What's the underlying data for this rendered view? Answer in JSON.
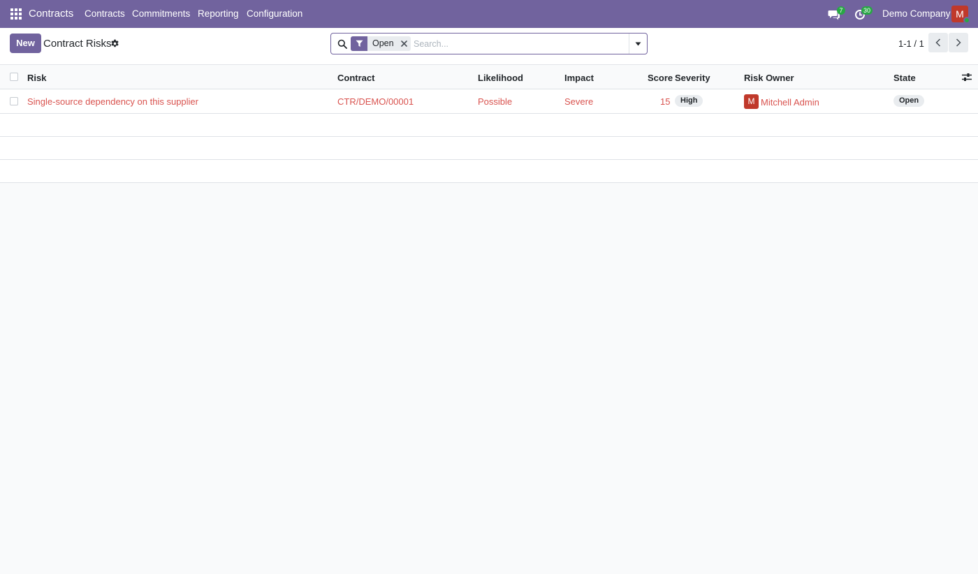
{
  "navbar": {
    "brand": "Contracts",
    "menu": [
      "Contracts",
      "Commitments",
      "Reporting",
      "Configuration"
    ],
    "messages_count": "7",
    "activities_count": "30",
    "company": "Demo Company",
    "user_initial": "M"
  },
  "control_panel": {
    "new_label": "New",
    "title": "Contract Risks",
    "search": {
      "facet": "Open",
      "placeholder": "Search..."
    },
    "pager": "1-1 / 1"
  },
  "list": {
    "columns": [
      "Risk",
      "Contract",
      "Likelihood",
      "Impact",
      "Score",
      "Severity",
      "Risk Owner",
      "State"
    ],
    "rows": [
      {
        "risk": "Single-source dependency on this supplier",
        "contract": "CTR/DEMO/00001",
        "likelihood": "Possible",
        "impact": "Severe",
        "score": "15",
        "severity": "High",
        "owner_initial": "M",
        "owner": "Mitchell Admin",
        "state": "Open"
      }
    ]
  },
  "colors": {
    "brand": "#71639e",
    "link": "#d9534f",
    "badge": "#28a745",
    "avatar": "#c0392b"
  },
  "icons": [
    "apps-grid-icon",
    "chat-icon",
    "activity-clock-icon",
    "gear-icon",
    "search-icon",
    "filter-icon",
    "close-icon",
    "caret-down-icon",
    "chevron-left-icon",
    "chevron-right-icon",
    "optional-columns-icon"
  ]
}
